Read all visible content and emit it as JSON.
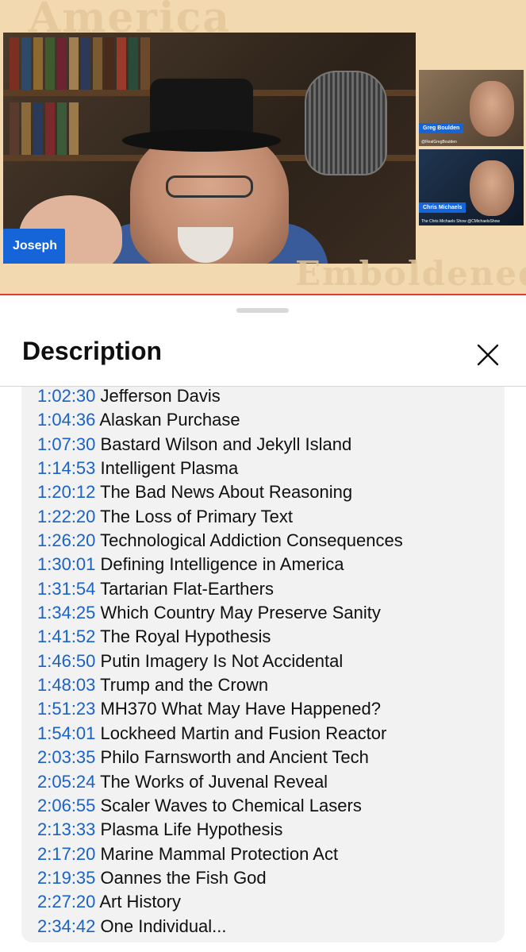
{
  "video": {
    "watermark_top": "America",
    "watermark_bottom": "Emboldened",
    "main_speaker_name": "Joseph",
    "side_participants": [
      {
        "name": "Greg Boulden",
        "handle": "@RealGregBoulden"
      },
      {
        "name": "Chris Michaels",
        "handle": "The Chris Michaels Show @CMichaelsShow"
      }
    ]
  },
  "sheet": {
    "title": "Description"
  },
  "chapters": [
    {
      "time": "1:02:30",
      "title": "Jefferson Davis"
    },
    {
      "time": "1:04:36",
      "title": "Alaskan Purchase"
    },
    {
      "time": "1:07:30",
      "title": "Bastard Wilson and Jekyll Island"
    },
    {
      "time": "1:14:53",
      "title": "Intelligent Plasma"
    },
    {
      "time": "1:20:12",
      "title": "The Bad News About Reasoning"
    },
    {
      "time": "1:22:20",
      "title": "The Loss of Primary Text"
    },
    {
      "time": "1:26:20",
      "title": "Technological Addiction Consequences"
    },
    {
      "time": "1:30:01",
      "title": "Defining Intelligence in America"
    },
    {
      "time": "1:31:54",
      "title": "Tartarian Flat-Earthers"
    },
    {
      "time": "1:34:25",
      "title": "Which Country May Preserve Sanity"
    },
    {
      "time": "1:41:52",
      "title": "The Royal Hypothesis"
    },
    {
      "time": "1:46:50",
      "title": "Putin Imagery Is Not Accidental"
    },
    {
      "time": "1:48:03",
      "title": "Trump and the Crown"
    },
    {
      "time": "1:51:23",
      "title": "MH370 What May Have Happened?"
    },
    {
      "time": "1:54:01",
      "title": "Lockheed Martin and Fusion Reactor"
    },
    {
      "time": "2:03:35",
      "title": "Philo Farnsworth and Ancient Tech"
    },
    {
      "time": "2:05:24",
      "title": "The Works of Juvenal Reveal"
    },
    {
      "time": "2:06:55",
      "title": "Scaler Waves to Chemical Lasers"
    },
    {
      "time": "2:13:33",
      "title": "Plasma Life Hypothesis"
    },
    {
      "time": "2:17:20",
      "title": "Marine Mammal Protection Act"
    },
    {
      "time": "2:19:35",
      "title": "Oannes the Fish God"
    },
    {
      "time": "2:27:20",
      "title": "Art History"
    },
    {
      "time": "2:34:42",
      "title": "One Individual..."
    }
  ],
  "colors": {
    "timestamp_link": "#1a62c6",
    "name_tag": "#1565d8",
    "progress": "#e53935"
  }
}
